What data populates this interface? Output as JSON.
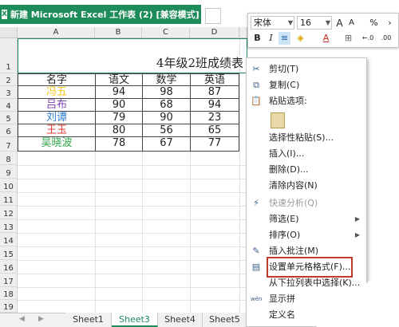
{
  "window": {
    "tab_title": "新建 Microsoft Excel 工作表 (2)  [兼容模式] *",
    "tab_close": "×",
    "app_icon_glyph": "X"
  },
  "columns": [
    "A",
    "B",
    "C",
    "D"
  ],
  "rows": [
    "1",
    "2",
    "3",
    "4",
    "5",
    "6",
    "7",
    "8",
    "9",
    "10",
    "11",
    "12",
    "13",
    "14",
    "15",
    "16",
    "17",
    "18",
    "19"
  ],
  "sheet": {
    "title": "4年级2班成绩表",
    "headers": [
      "名字",
      "语文",
      "数学",
      "英语"
    ],
    "records": [
      {
        "name": "冯五",
        "name_color": "#f5c518",
        "scores": [
          "94",
          "98",
          "87"
        ]
      },
      {
        "name": "吕布",
        "name_color": "#7b3fb5",
        "scores": [
          "90",
          "68",
          "94"
        ]
      },
      {
        "name": "刘谭",
        "name_color": "#2f7fd6",
        "scores": [
          "79",
          "90",
          "23"
        ]
      },
      {
        "name": "王玉",
        "name_color": "#e53935",
        "scores": [
          "80",
          "56",
          "65"
        ]
      },
      {
        "name": "吴晓波",
        "name_color": "#2ea84a",
        "scores": [
          "78",
          "67",
          "77"
        ]
      }
    ]
  },
  "sheet_tabs": [
    "Sheet1",
    "Sheet3",
    "Sheet4",
    "Sheet5"
  ],
  "active_sheet": "Sheet3",
  "mini_toolbar": {
    "font_name": "宋体",
    "font_size": "16",
    "grow_font": "A",
    "shrink_font": "A",
    "percent": "%",
    "comma": "›",
    "bold": "B",
    "italic": "I",
    "align": "≡",
    "fill_color": "◈",
    "font_color": "A",
    "borders": "⊞",
    "dec_increase": "←.0",
    "dec_decrease": ".00",
    "paint": "✓"
  },
  "context_menu": [
    {
      "icon": "✂",
      "label": "剪切(T)",
      "enabled": true
    },
    {
      "icon": "⧉",
      "label": "复制(C)",
      "enabled": true
    },
    {
      "icon": "📋",
      "label": "粘贴选项:",
      "enabled": true
    },
    {
      "icon": "",
      "label": "",
      "enabled": true
    },
    {
      "icon": "",
      "label": "选择性粘贴(S)...",
      "enabled": true
    },
    {
      "icon": "",
      "label": "插入(I)...",
      "enabled": true
    },
    {
      "icon": "",
      "label": "删除(D)...",
      "enabled": true
    },
    {
      "icon": "",
      "label": "清除内容(N)",
      "enabled": true
    },
    {
      "icon": "⚡",
      "label": "快速分析(Q)",
      "enabled": false
    },
    {
      "icon": "",
      "label": "筛选(E)",
      "enabled": true,
      "submenu": true
    },
    {
      "icon": "",
      "label": "排序(O)",
      "enabled": true,
      "submenu": true
    },
    {
      "icon": "✎",
      "label": "插入批注(M)",
      "enabled": true
    },
    {
      "icon": "▤",
      "label": "设置单元格格式(F)...",
      "enabled": true,
      "highlighted": true
    },
    {
      "icon": "",
      "label": "从下拉列表中选择(K)...",
      "enabled": true
    },
    {
      "icon": "wén",
      "label": "显示拼",
      "enabled": true
    },
    {
      "icon": "",
      "label": "定义名",
      "enabled": true
    }
  ],
  "submenu_arrow": "▶",
  "nav_arrows": [
    "◀",
    "▶"
  ]
}
